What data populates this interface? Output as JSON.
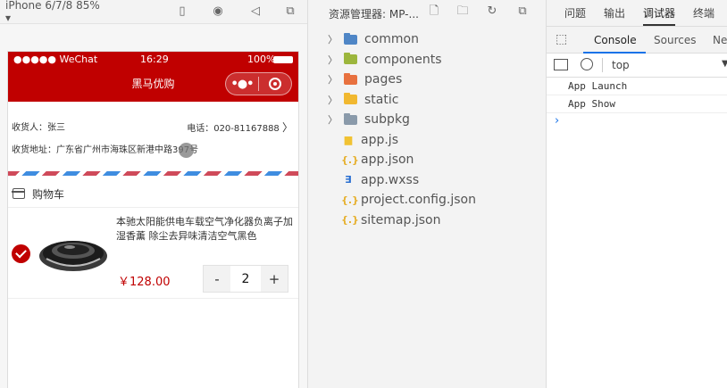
{
  "simulator": {
    "device_label": "iPhone 6/7/8 85% ▾",
    "toolbar_icons": [
      "phone-icon",
      "record-icon",
      "speaker-icon",
      "window-icon"
    ],
    "status": {
      "signal": "●●●●● WeChat",
      "time": "16:29",
      "battery": "100%"
    },
    "nav_title": "黑马优购",
    "capsule": {
      "more": "•●•"
    },
    "address": {
      "receiver_label": "收货人：张三",
      "phone_label": "电话：020-81167888",
      "address_label": "收货地址：广东省广州市海珠区新港中路397号"
    },
    "cart": {
      "title": "购物车",
      "item": {
        "name": "本驰太阳能供电车载空气净化器负离子加湿香薰 除尘去异味清洁空气黑色",
        "price": "￥128.00",
        "quantity": "2",
        "minus": "-",
        "plus": "+"
      }
    }
  },
  "explorer": {
    "title": "资源管理器: MP-...",
    "items": [
      {
        "name": "common",
        "type": "folder",
        "color": "#4f86c6"
      },
      {
        "name": "components",
        "type": "folder",
        "color": "#9cb63d"
      },
      {
        "name": "pages",
        "type": "folder",
        "color": "#e8713f"
      },
      {
        "name": "static",
        "type": "folder",
        "color": "#f1b830"
      },
      {
        "name": "subpkg",
        "type": "folder",
        "color": "#8a9aaa"
      },
      {
        "name": "app.js",
        "type": "js",
        "color": "#f1c232"
      },
      {
        "name": "app.json",
        "type": "json",
        "color": "#e6b02e"
      },
      {
        "name": "app.wxss",
        "type": "wxss",
        "color": "#2a6fd1"
      },
      {
        "name": "project.config.json",
        "type": "json",
        "color": "#e6b02e"
      },
      {
        "name": "sitemap.json",
        "type": "json",
        "color": "#e6b02e"
      }
    ]
  },
  "devtools": {
    "tabs": [
      "问题",
      "输出",
      "调试器",
      "终端"
    ],
    "active_tab": "调试器",
    "panel_tabs": [
      "Console",
      "Sources",
      "Ne"
    ],
    "filter_context": "top",
    "logs": [
      "App Launch",
      "App Show"
    ],
    "prompt": "›"
  }
}
